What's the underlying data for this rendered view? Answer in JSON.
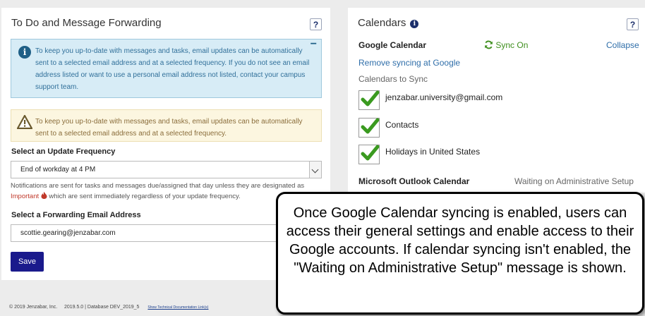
{
  "forwarding": {
    "title": "To Do and Message Forwarding",
    "help": "?",
    "info_alert": "To keep you up-to-date with messages and tasks, email updates can be automatically sent to a selected email address and at a selected frequency. If you do not see an email address listed or want to use a personal email address not listed, contact your campus support team.",
    "info_collapse": "−",
    "warning_alert": "To keep you up-to-date with messages and tasks, email updates can be automatically sent to a selected email address and at a selected frequency.",
    "frequency_label": "Select an Update Frequency",
    "frequency_value": "End of workday at 4 PM",
    "note_before": "Notifications are sent for tasks and messages due/assigned that day unless they are designated as",
    "note_important": "Important",
    "note_after": "which are sent immediately regardless of your update frequency.",
    "email_label": "Select a Forwarding Email Address",
    "email_value": "scottie.gearing@jenzabar.com",
    "save_label": "Save"
  },
  "calendars": {
    "title": "Calendars",
    "help": "?",
    "google_title": "Google Calendar",
    "sync_status": "Sync On",
    "collapse_label": "Collapse",
    "remove_link": "Remove syncing at Google",
    "sync_label": "Calendars to Sync",
    "items": [
      {
        "label": "jenzabar.university@gmail.com",
        "checked": true
      },
      {
        "label": "Contacts",
        "checked": true
      },
      {
        "label": "Holidays in United States",
        "checked": true
      }
    ],
    "outlook_title": "Microsoft Outlook Calendar",
    "outlook_status": "Waiting on Administrative Setup"
  },
  "footer": {
    "copyright": "© 2019 Jenzabar, Inc.",
    "version": "2019.5.0 | Database DEV_2019_5",
    "doc_link": "Show Technical Documentation Link(s)"
  },
  "callout": {
    "text": "Once Google Calendar syncing is enabled, users can access their general settings and enable access to their Google accounts. If calendar syncing isn't enabled, the \"Waiting on Administrative Setup\" message is shown."
  },
  "colors": {
    "save_button": "#1a1a8c",
    "info_bg": "#d7ecf6",
    "warning_bg": "#fcf6e0",
    "link": "#2f6ea9",
    "sync_green": "#3f8f1e",
    "check_green": "#3a9a1f"
  }
}
